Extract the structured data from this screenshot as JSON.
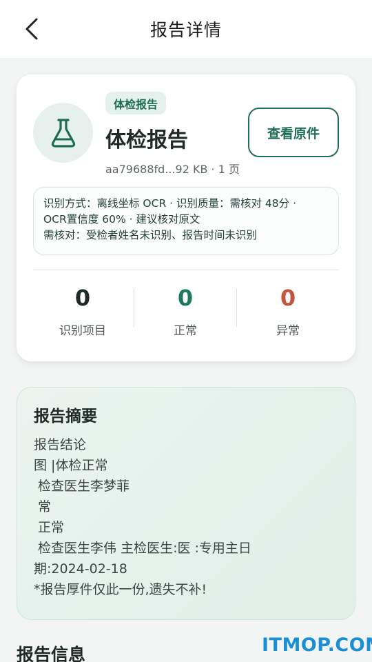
{
  "header": {
    "title": "报告详情"
  },
  "card": {
    "tag": "体检报告",
    "title": "体检报告",
    "meta": "aa79688fd...92 KB · 1 页",
    "view_button": "查看原件",
    "ocr_lines": [
      "识别方式：离线坐标 OCR · 识别质量：需核对 48分 ·",
      "OCR置信度 60% · 建议核对原文",
      "需核对：受检者姓名未识别、报告时间未识别"
    ],
    "stats": [
      {
        "value": "0",
        "label": "识别项目",
        "color": "#1f2a27"
      },
      {
        "value": "0",
        "label": "正常",
        "color": "#1f7a5a"
      },
      {
        "value": "0",
        "label": "异常",
        "color": "#c4553f"
      }
    ]
  },
  "summary": {
    "title": "报告摘要",
    "lines": [
      "报告结论",
      "图 |体检正常",
      " 检查医生李梦菲",
      " 常",
      " 正常",
      " 检查医生李伟 主检医生:医 :专用主日",
      "期:2024-02-18",
      "*报告厚件仅此一份,遗失不补!"
    ]
  },
  "info": {
    "title": "报告信息"
  },
  "watermark": "ITMOP.COM",
  "colors": {
    "accent": "#1f6e54",
    "normal": "#1f7a5a",
    "abnormal": "#c4553f"
  }
}
